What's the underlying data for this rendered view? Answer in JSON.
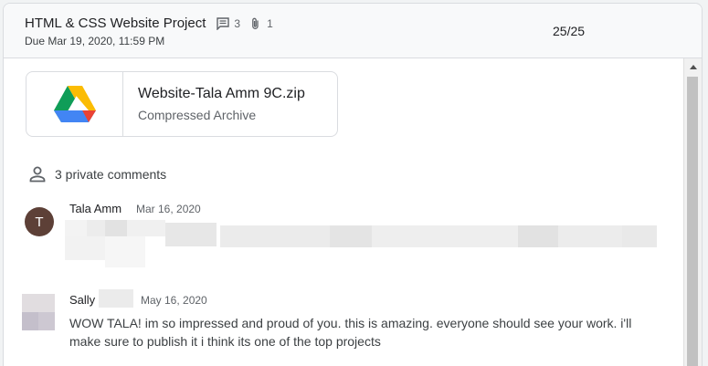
{
  "header": {
    "title": "HTML & CSS Website Project",
    "comment_count": "3",
    "attachment_count": "1",
    "due": "Due Mar 19, 2020, 11:59 PM",
    "grade": "25/25"
  },
  "attachment": {
    "name": "Website-Tala Amm 9C.zip",
    "type": "Compressed Archive",
    "icon": "google-drive-icon"
  },
  "comments": {
    "heading": "3 private comments",
    "items": [
      {
        "author": "Tala Amm",
        "initial": "T",
        "date": "Mar 16, 2020",
        "avatar_color": "#5d4037"
      },
      {
        "author": "Sally",
        "date": "May 16, 2020",
        "text": "WOW TALA! im so impressed and proud of you. this is amazing. everyone should see your work. i'll make sure to publish it i think its one of the top projects"
      }
    ]
  },
  "colors": {
    "header_bg": "#f8f9fa",
    "border": "#dadce0",
    "text_primary": "#202124",
    "text_secondary": "#5f6368"
  }
}
